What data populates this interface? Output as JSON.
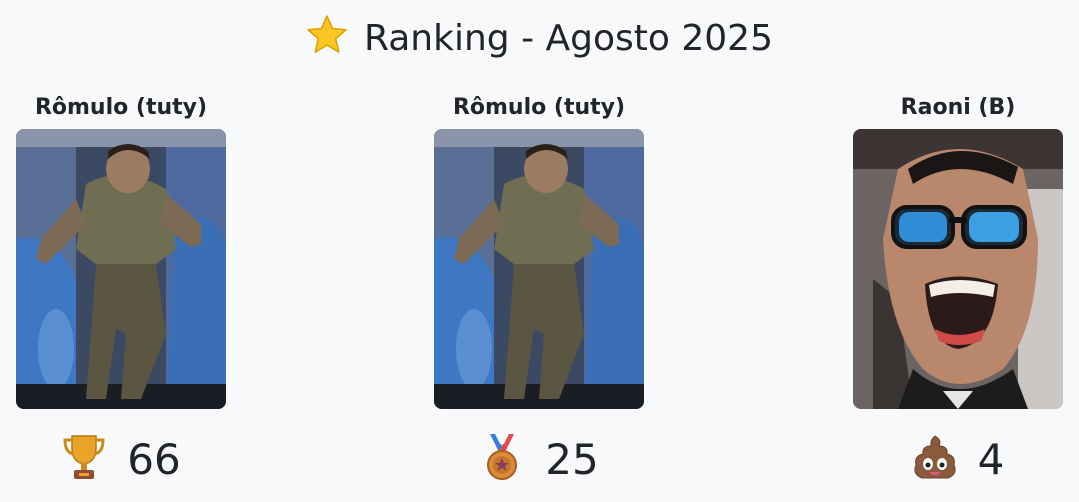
{
  "header": {
    "title": "Ranking - Agosto 2025",
    "icon": "star-icon",
    "icon_color": "#f9c623"
  },
  "ranking": [
    {
      "name": "Rômulo (tuty)",
      "score": "66",
      "badge_icon": "trophy-icon",
      "photo": "man-in-camouflage-dancing-on-bus"
    },
    {
      "name": "Rômulo (tuty)",
      "score": "25",
      "badge_icon": "bronze-medal-icon",
      "photo": "man-in-camouflage-dancing-on-bus"
    },
    {
      "name": "Raoni (B)",
      "score": "4",
      "badge_icon": "pile-of-poo-icon",
      "photo": "man-with-blue-mirrored-sunglasses-in-car"
    }
  ]
}
